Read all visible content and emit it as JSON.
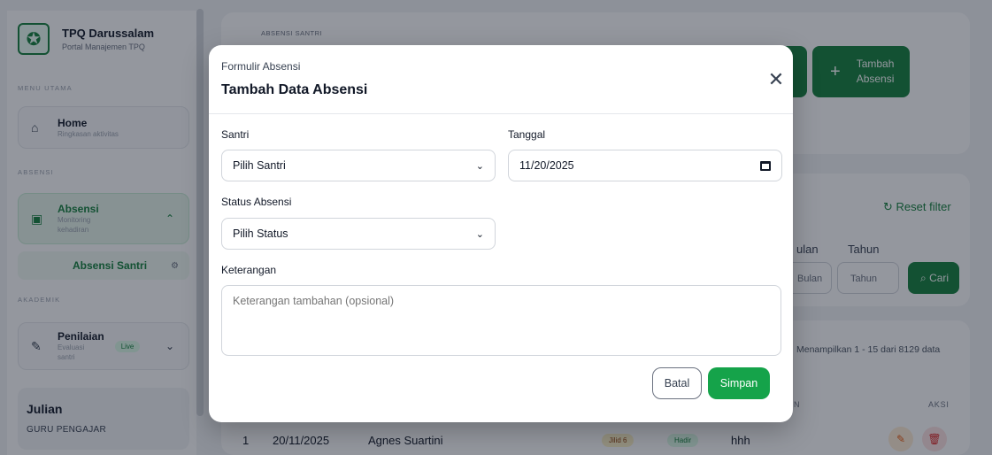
{
  "brand": {
    "title": "TPQ Darussalam",
    "subtitle": "Portal Manajemen TPQ"
  },
  "sidebar": {
    "section_main": "MENU UTAMA",
    "home": {
      "title": "Home",
      "subtitle": "Ringkasan aktivitas"
    },
    "section_absensi": "ABSENSI",
    "absensi": {
      "title": "Absensi",
      "subtitle_1": "Monitoring",
      "subtitle_2": "kehadiran"
    },
    "absensi_sub": "Absensi Santri",
    "section_akademik": "AKADEMIK",
    "penilaian": {
      "title": "Penilaian",
      "subtitle_1": "Evaluasi",
      "subtitle_2": "santri",
      "badge": "Live"
    }
  },
  "user": {
    "name": "Julian",
    "role": "GURU PENGAJAR"
  },
  "background": {
    "breadcrumb": "ABSENSI SANTRI",
    "add_button_1": "Tambah",
    "add_button_2": "Absensi",
    "reset_filter": "Reset filter",
    "label_bulan": "ulan",
    "label_tahun": "Tahun",
    "placeholder_bulan": "Bulan",
    "placeholder_tahun": "Tahun",
    "search_button": "Cari",
    "showing": "Menampilkan 1 - 15 dari 8129 data",
    "col_partial": "N",
    "col_aksi": "AKSI",
    "row": {
      "no": "1",
      "date": "20/11/2025",
      "name": "Agnes Suartini",
      "jilid": "Jilid 6",
      "status": "Hadir",
      "note": "hhh"
    }
  },
  "modal": {
    "overline": "Formulir Absensi",
    "title": "Tambah Data Absensi",
    "santri_label": "Santri",
    "santri_value": "Pilih Santri",
    "tanggal_label": "Tanggal",
    "tanggal_value": "11/20/2025",
    "status_label": "Status Absensi",
    "status_value": "Pilih Status",
    "keterangan_label": "Keterangan",
    "keterangan_placeholder": "Keterangan tambahan (opsional)",
    "cancel_label": "Batal",
    "save_label": "Simpan"
  },
  "colors": {
    "accent": "#15803d",
    "save": "#15a34a"
  }
}
